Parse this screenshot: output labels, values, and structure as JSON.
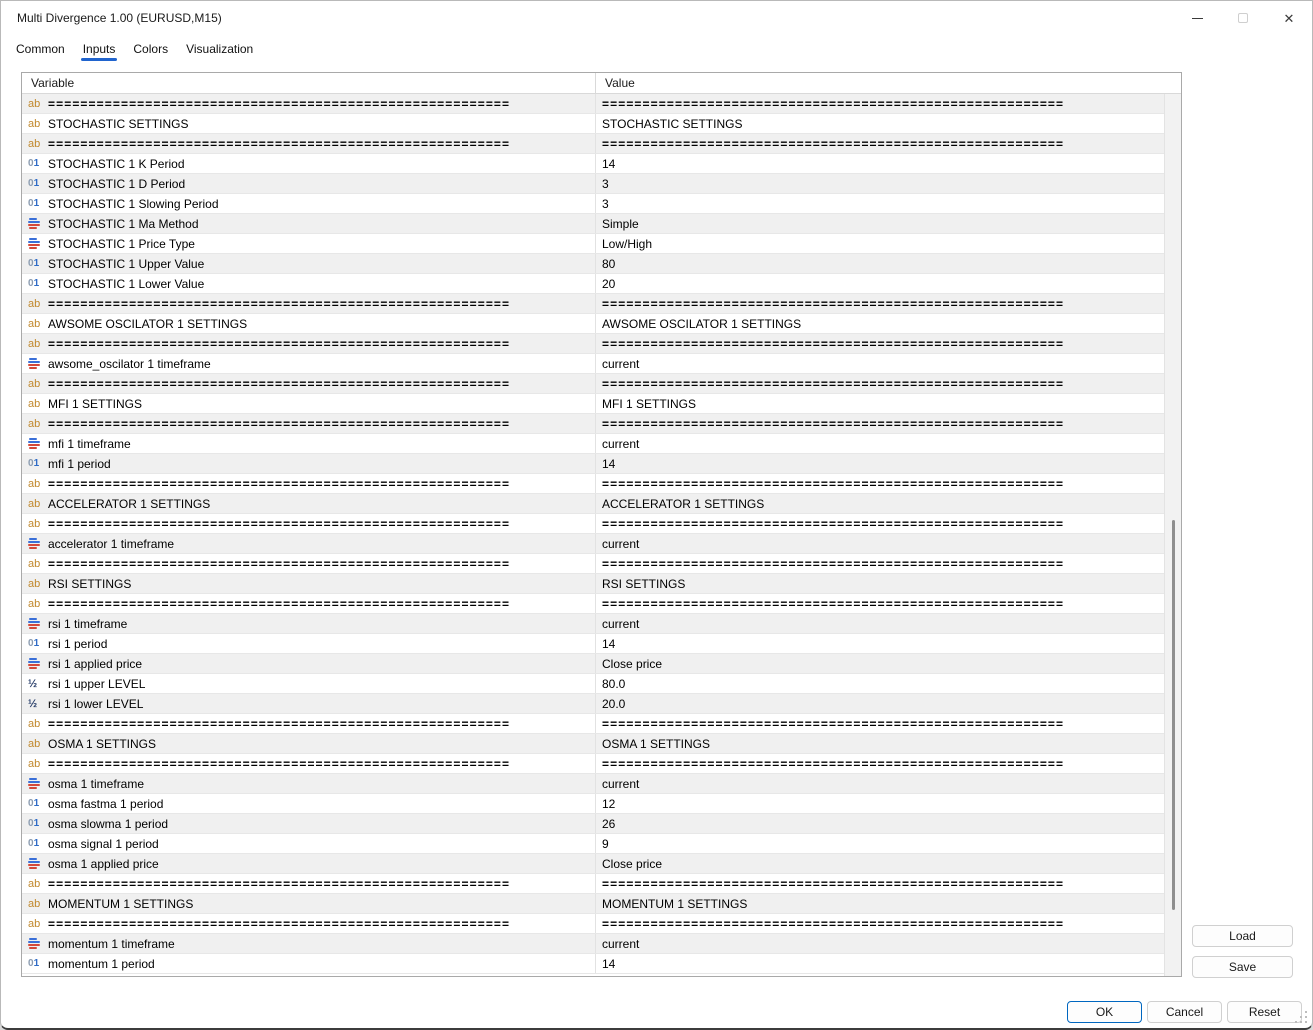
{
  "window": {
    "title": "Multi Divergence 1.00 (EURUSD,M15)",
    "controls": {
      "minimize": "–",
      "maximize": "maximize",
      "close": "✕"
    }
  },
  "tabs": [
    {
      "label": "Common",
      "active": false
    },
    {
      "label": "Inputs",
      "active": true
    },
    {
      "label": "Colors",
      "active": false
    },
    {
      "label": "Visualization",
      "active": false
    }
  ],
  "table": {
    "columns": [
      "Variable",
      "Value"
    ],
    "separator_text": "=========================================================",
    "icon_glyphs": {
      "text": "ab",
      "int": "01",
      "double": "½"
    },
    "rows": [
      {
        "type": "sep"
      },
      {
        "type": "text",
        "name": "STOCHASTIC  SETTINGS",
        "value": " STOCHASTIC  SETTINGS"
      },
      {
        "type": "sep"
      },
      {
        "type": "int",
        "name": "STOCHASTIC 1 K Period",
        "value": "14"
      },
      {
        "type": "int",
        "name": "STOCHASTIC 1 D Period",
        "value": "3"
      },
      {
        "type": "int",
        "name": "STOCHASTIC 1 Slowing Period",
        "value": "3"
      },
      {
        "type": "enum",
        "name": "STOCHASTIC 1 Ma Method",
        "value": "Simple"
      },
      {
        "type": "enum",
        "name": "STOCHASTIC 1 Price Type",
        "value": "Low/High"
      },
      {
        "type": "int",
        "name": "STOCHASTIC 1 Upper Value",
        "value": "80"
      },
      {
        "type": "int",
        "name": "STOCHASTIC 1 Lower Value",
        "value": "20"
      },
      {
        "type": "sep"
      },
      {
        "type": "text",
        "name": "AWSOME OSCILATOR 1 SETTINGS",
        "value": " AWSOME OSCILATOR 1 SETTINGS"
      },
      {
        "type": "sep"
      },
      {
        "type": "enum",
        "name": "awsome_oscilator 1 timeframe",
        "value": "current"
      },
      {
        "type": "sep"
      },
      {
        "type": "text",
        "name": "MFI 1 SETTINGS",
        "value": "MFI 1 SETTINGS"
      },
      {
        "type": "sep"
      },
      {
        "type": "enum",
        "name": "mfi 1 timeframe",
        "value": "current"
      },
      {
        "type": "int",
        "name": "mfi 1 period",
        "value": "14"
      },
      {
        "type": "sep"
      },
      {
        "type": "text",
        "name": "ACCELERATOR 1 SETTINGS",
        "value": " ACCELERATOR 1 SETTINGS"
      },
      {
        "type": "sep"
      },
      {
        "type": "enum",
        "name": "accelerator 1 timeframe",
        "value": "current"
      },
      {
        "type": "sep"
      },
      {
        "type": "text",
        "name": "RSI SETTINGS",
        "value": "RSI SETTINGS"
      },
      {
        "type": "sep"
      },
      {
        "type": "enum",
        "name": "rsi 1 timeframe",
        "value": "current"
      },
      {
        "type": "int",
        "name": "rsi 1 period",
        "value": "14"
      },
      {
        "type": "enum",
        "name": "rsi 1 applied price",
        "value": "Close price"
      },
      {
        "type": "double",
        "name": "rsi 1 upper LEVEL",
        "value": "80.0"
      },
      {
        "type": "double",
        "name": "rsi 1 lower LEVEL",
        "value": "20.0"
      },
      {
        "type": "sep"
      },
      {
        "type": "text",
        "name": "OSMA 1 SETTINGS",
        "value": " OSMA 1 SETTINGS"
      },
      {
        "type": "sep"
      },
      {
        "type": "enum",
        "name": "osma 1 timeframe",
        "value": "current"
      },
      {
        "type": "int",
        "name": "osma fastma 1 period",
        "value": "12"
      },
      {
        "type": "int",
        "name": "osma slowma 1 period",
        "value": "26"
      },
      {
        "type": "int",
        "name": "osma signal 1 period",
        "value": "9"
      },
      {
        "type": "enum",
        "name": "osma 1 applied price",
        "value": "Close price"
      },
      {
        "type": "sep"
      },
      {
        "type": "text",
        "name": "MOMENTUM 1 SETTINGS",
        "value": " MOMENTUM 1 SETTINGS"
      },
      {
        "type": "sep"
      },
      {
        "type": "enum",
        "name": "momentum 1 timeframe",
        "value": "current"
      },
      {
        "type": "int",
        "name": "momentum 1 period",
        "value": "14"
      }
    ]
  },
  "buttons": {
    "load": "Load",
    "save": "Save",
    "ok": "OK",
    "cancel": "Cancel",
    "reset": "Reset"
  },
  "colors": {
    "accent_tab_underline": "#2064ce",
    "ok_button_border": "#0067c0",
    "row_stripe": "#f0f0f0",
    "text_param_icon": "#c1882b",
    "int_param_icon": "#2f6bc6",
    "enum_icon_blue": "#3a6fd8",
    "enum_icon_red": "#d4483a",
    "double_param_icon": "#243a66"
  }
}
